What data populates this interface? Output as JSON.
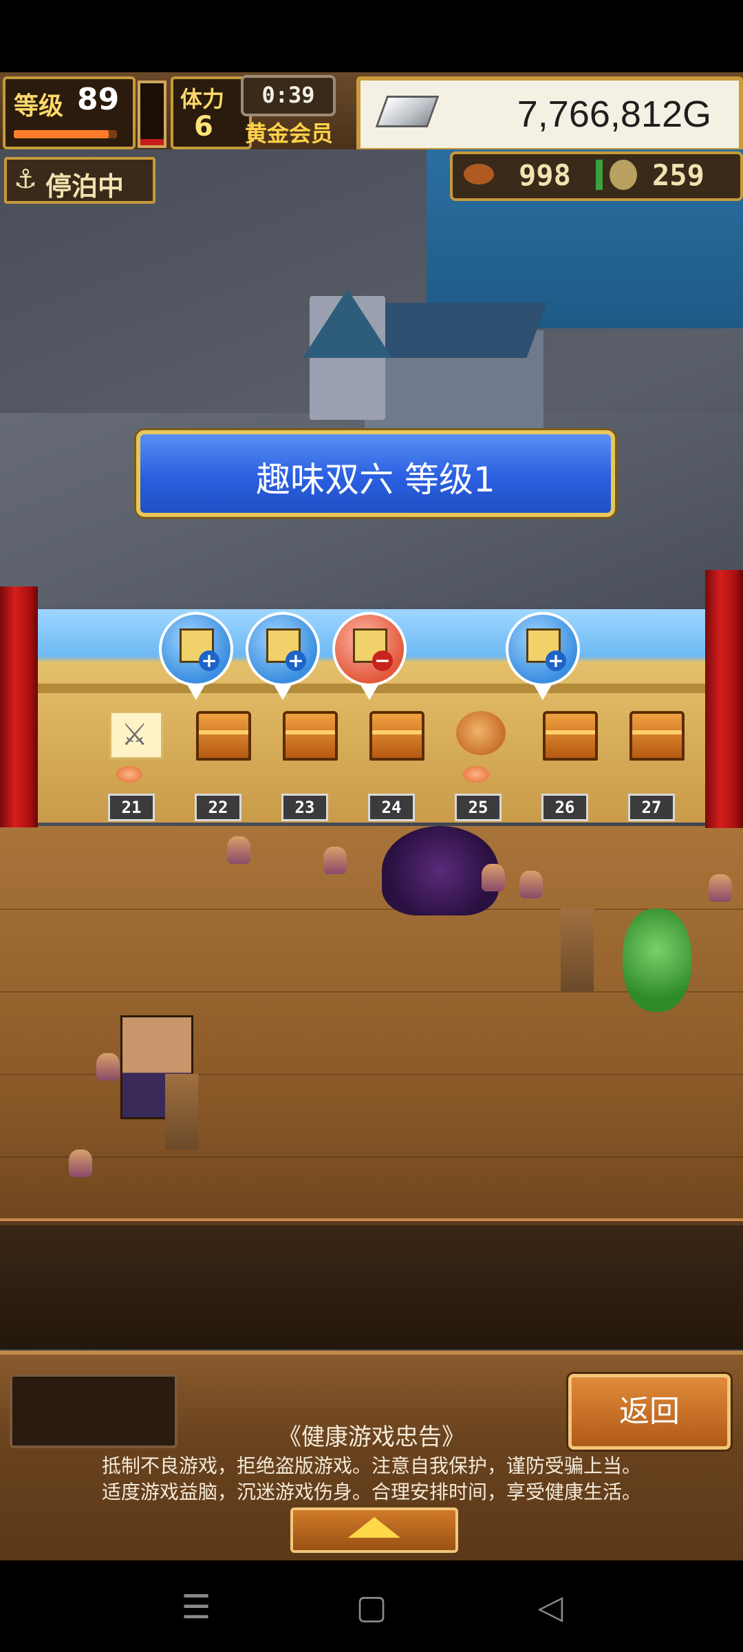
{
  "hud": {
    "level_label": "等级",
    "level_value": "89",
    "level_progress": 0.92,
    "stamina_label": "体力",
    "stamina_value": "6",
    "stamina_fill": 0.1,
    "timer": "0:39",
    "membership": "黄金会员",
    "gold": "7,766,812G"
  },
  "status_pill": {
    "label": "停泊中",
    "icon": "anchor-icon"
  },
  "resources": {
    "meat": "998",
    "medals": "259"
  },
  "event_title": "趣味双六 等级1",
  "board": {
    "spaces": [
      {
        "num": "21",
        "item": "sword",
        "dot": true
      },
      {
        "num": "22",
        "item": "chest",
        "dot": false
      },
      {
        "num": "23",
        "item": "chest",
        "dot": false
      },
      {
        "num": "24",
        "item": "chest",
        "dot": false
      },
      {
        "num": "25",
        "item": "food",
        "dot": true
      },
      {
        "num": "26",
        "item": "chest",
        "dot": false
      },
      {
        "num": "27",
        "item": "chest",
        "dot": false
      }
    ],
    "pins": [
      {
        "type": "blue",
        "badge": "+"
      },
      {
        "type": "blue",
        "badge": "+"
      },
      {
        "type": "red",
        "badge": "−"
      },
      {
        "type": "blue",
        "badge": "+"
      }
    ]
  },
  "bottom": {
    "back_label": "返回",
    "notice_title": "《健康游戏忠告》",
    "notice_line_1": "抵制不良游戏，拒绝盗版游戏。注意自我保护，谨防受骗上当。",
    "notice_line_2": "适度游戏益脑，沉迷游戏伤身。合理安排时间，享受健康生活。"
  },
  "nav": {
    "menu_icon": "☰",
    "home_icon": "▢",
    "back_icon": "◁"
  },
  "colors": {
    "banner": "#2a5fe0",
    "gold_border": "#c99b3c",
    "curtain": "#d61e1e"
  }
}
